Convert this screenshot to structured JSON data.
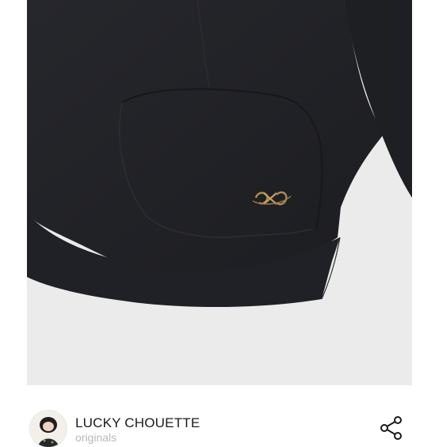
{
  "product": {
    "image_icon": "jacket-closeup-photo",
    "logo_icon": "gold-monogram-emblem"
  },
  "brand": {
    "name": "LUCKY CHOUETTE",
    "subtitle": "originals",
    "avatar_icon": "brand-avatar"
  },
  "actions": {
    "share_icon": "share-icon"
  },
  "colors": {
    "photo_background": "#ebebeb",
    "garment": "#1f2024",
    "emblem_gold": "#b08d4f",
    "brand_text": "#1b1b1b",
    "subtitle_text": "#b8b8b8"
  }
}
